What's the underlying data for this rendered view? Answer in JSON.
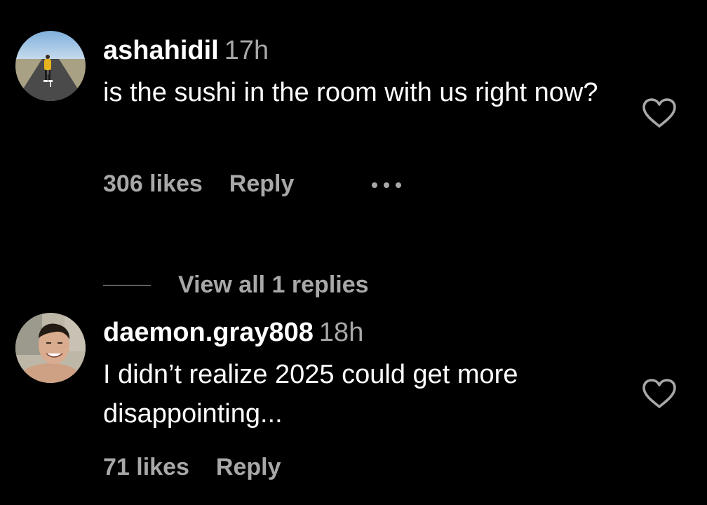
{
  "comments": [
    {
      "username": "ashahidil",
      "time": "17h",
      "text": "is the sushi in the room with us right now?",
      "likes": "306 likes",
      "reply_label": "Reply",
      "avatar": "person-on-road-photo"
    },
    {
      "username": "daemon.gray808",
      "time": "18h",
      "text": "I didn’t realize 2025 could get more disappointing...",
      "likes": "71 likes",
      "reply_label": "Reply",
      "avatar": "smiling-man-selfie-photo"
    }
  ],
  "view_replies": "View all 1 replies",
  "icons": {
    "like": "heart-outline-icon",
    "more": "more-horizontal-icon"
  },
  "colors": {
    "background": "#000000",
    "primary_text": "#ffffff",
    "secondary_text": "#a8a8a8"
  }
}
